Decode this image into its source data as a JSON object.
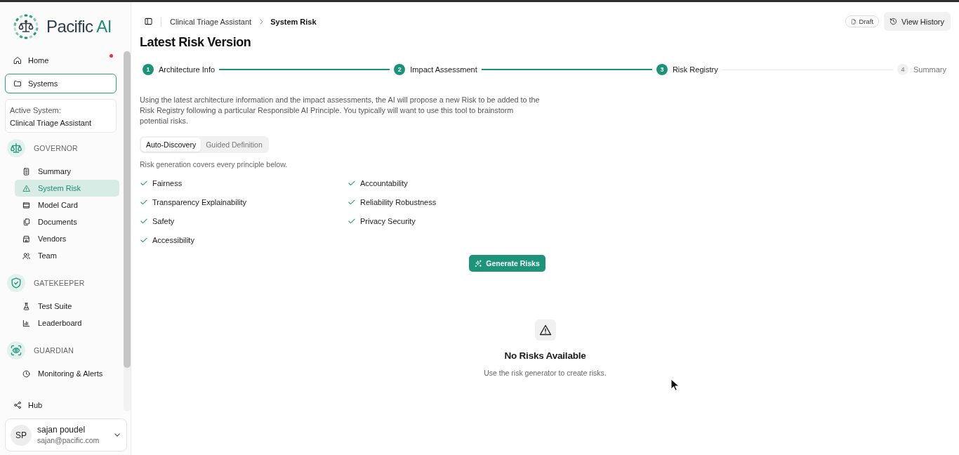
{
  "logo": {
    "wordmark": "Pacific",
    "accent": "AI"
  },
  "sidebar": {
    "nav_top": [
      {
        "label": "Home",
        "selected": false,
        "notification": true
      },
      {
        "label": "Systems",
        "selected": true,
        "notification": false
      }
    ],
    "active_system": {
      "label": "Active System:",
      "value": "Clinical Triage Assistant"
    },
    "sections": [
      {
        "title": "GOVERNOR",
        "items": [
          {
            "label": "Summary",
            "selected": false
          },
          {
            "label": "System Risk",
            "selected": true
          },
          {
            "label": "Model Card",
            "selected": false
          },
          {
            "label": "Documents",
            "selected": false
          },
          {
            "label": "Vendors",
            "selected": false
          },
          {
            "label": "Team",
            "selected": false
          }
        ]
      },
      {
        "title": "GATEKEEPER",
        "items": [
          {
            "label": "Test Suite",
            "selected": false
          },
          {
            "label": "Leaderboard",
            "selected": false
          }
        ]
      },
      {
        "title": "GUARDIAN",
        "items": [
          {
            "label": "Monitoring & Alerts",
            "selected": false
          }
        ]
      }
    ],
    "bottom_items": [
      {
        "label": "Hub",
        "selected": false
      }
    ],
    "user": {
      "initials": "SP",
      "name": "sajan poudel",
      "email": "sajan@pacific.com"
    }
  },
  "header": {
    "breadcrumb": [
      {
        "label": "Clinical Triage Assistant",
        "current": false
      },
      {
        "label": "System Risk",
        "current": true
      }
    ],
    "status_badge": "Draft",
    "history_button": "View History"
  },
  "page": {
    "title": "Latest Risk Version"
  },
  "stepper": [
    {
      "number": "1",
      "label": "Architecture Info",
      "active": true
    },
    {
      "number": "2",
      "label": "Impact Assessment",
      "active": true
    },
    {
      "number": "3",
      "label": "Risk Registry",
      "active": true
    },
    {
      "number": "4",
      "label": "Summary",
      "active": false
    }
  ],
  "description": "Using the latest architecture information and the impact assessments, the AI will propose a new Risk to be added to the Risk Registry following a particular Responsible AI Principle. You typically will want to use this tool to brainstorm potential risks.",
  "mode_tabs": [
    {
      "label": "Auto-Discovery",
      "selected": true
    },
    {
      "label": "Guided Definition",
      "selected": false
    }
  ],
  "principles": {
    "caption": "Risk generation covers every principle below.",
    "items": [
      {
        "label": "Fairness",
        "checked": true
      },
      {
        "label": "Accountability",
        "checked": true
      },
      {
        "label": "Transparency Explainability",
        "checked": true
      },
      {
        "label": "Reliability Robustness",
        "checked": true
      },
      {
        "label": "Safety",
        "checked": true
      },
      {
        "label": "Privacy Security",
        "checked": true
      },
      {
        "label": "Accessibility",
        "checked": true
      }
    ]
  },
  "generate_button": "Generate Risks",
  "empty_state": {
    "title": "No Risks Available",
    "message": "Use the risk generator to create risks."
  }
}
